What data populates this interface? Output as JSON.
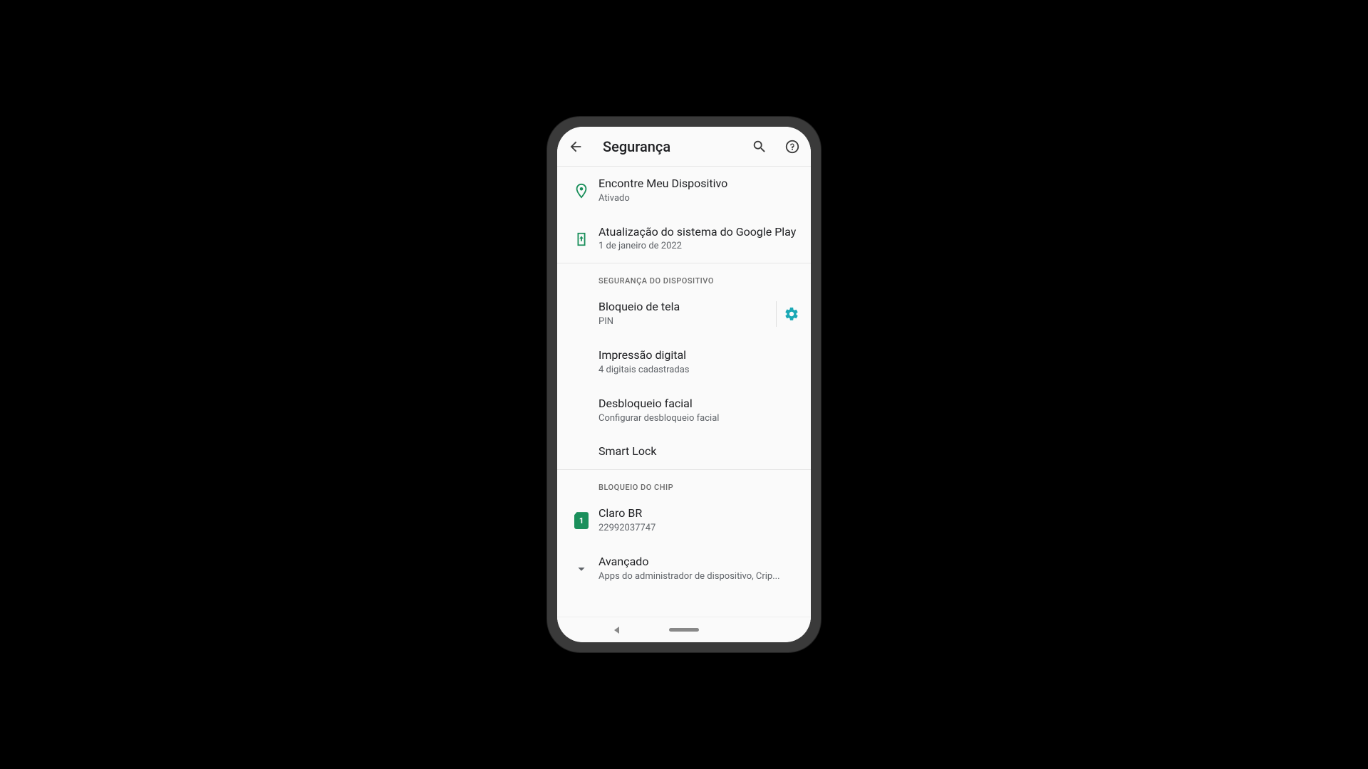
{
  "appbar": {
    "title": "Segurança"
  },
  "items": {
    "find_device": {
      "title": "Encontre Meu Dispositivo",
      "subtitle": "Ativado"
    },
    "play_update": {
      "title": "Atualização do sistema do Google Play",
      "subtitle": "1 de janeiro de 2022"
    }
  },
  "sections": {
    "device_security": {
      "header": "SEGURANÇA DO DISPOSITIVO",
      "screen_lock": {
        "title": "Bloqueio de tela",
        "subtitle": "PIN"
      },
      "fingerprint": {
        "title": "Impressão digital",
        "subtitle": "4 digitais cadastradas"
      },
      "face_unlock": {
        "title": "Desbloqueio facial",
        "subtitle": "Configurar desbloqueio facial"
      },
      "smart_lock": {
        "title": "Smart Lock"
      }
    },
    "sim_lock": {
      "header": "BLOQUEIO DO CHIP",
      "sim": {
        "title": "Claro BR",
        "subtitle": "22992037747",
        "badge": "1"
      }
    }
  },
  "advanced": {
    "title": "Avançado",
    "subtitle": "Apps do administrador de dispositivo, Crip..."
  },
  "colors": {
    "icon_green": "#1a8f5b",
    "gear_teal": "#1aa8b5"
  }
}
